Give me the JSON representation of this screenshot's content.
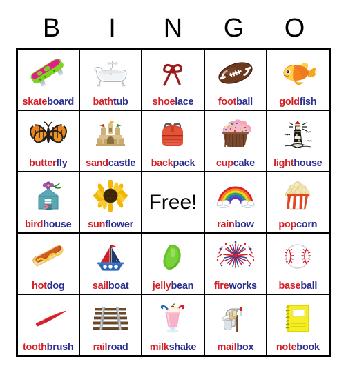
{
  "header": {
    "letters": [
      "B",
      "I",
      "N",
      "G",
      "O"
    ]
  },
  "colors": {
    "syllable_first": "#d31f26",
    "syllable_second": "#2b2f8f",
    "free_text": "#000000",
    "grid_line": "#000000",
    "background": "#ffffff"
  },
  "free_space": {
    "label": "Free!"
  },
  "grid": {
    "rows": 5,
    "columns": 5,
    "cells": [
      [
        {
          "word": "skateboard",
          "seg_a": "skate",
          "seg_b": "board",
          "icon": "skateboard-icon"
        },
        {
          "word": "bathtub",
          "seg_a": "bath",
          "seg_b": "tub",
          "icon": "bathtub-icon"
        },
        {
          "word": "shoelace",
          "seg_a": "shoe",
          "seg_b": "lace",
          "icon": "shoelace-icon"
        },
        {
          "word": "football",
          "seg_a": "foot",
          "seg_b": "ball",
          "icon": "football-icon"
        },
        {
          "word": "goldfish",
          "seg_a": "gold",
          "seg_b": "fish",
          "icon": "goldfish-icon"
        }
      ],
      [
        {
          "word": "butterfly",
          "seg_a": "butter",
          "seg_b": "fly",
          "icon": "butterfly-icon"
        },
        {
          "word": "sandcastle",
          "seg_a": "sand",
          "seg_b": "castle",
          "icon": "sandcastle-icon"
        },
        {
          "word": "backpack",
          "seg_a": "back",
          "seg_b": "pack",
          "icon": "backpack-icon"
        },
        {
          "word": "cupcake",
          "seg_a": "cup",
          "seg_b": "cake",
          "icon": "cupcake-icon"
        },
        {
          "word": "lighthouse",
          "seg_a": "light",
          "seg_b": "house",
          "icon": "lighthouse-icon"
        }
      ],
      [
        {
          "word": "birdhouse",
          "seg_a": "bird",
          "seg_b": "house",
          "icon": "birdhouse-icon"
        },
        {
          "word": "sunflower",
          "seg_a": "sun",
          "seg_b": "flower",
          "icon": "sunflower-icon"
        },
        {
          "word": "Free!",
          "seg_a": "",
          "seg_b": "",
          "icon": "free-space"
        },
        {
          "word": "rainbow",
          "seg_a": "rain",
          "seg_b": "bow",
          "icon": "rainbow-icon"
        },
        {
          "word": "popcorn",
          "seg_a": "pop",
          "seg_b": "corn",
          "icon": "popcorn-icon"
        }
      ],
      [
        {
          "word": "hotdog",
          "seg_a": "hot",
          "seg_b": "dog",
          "icon": "hotdog-icon"
        },
        {
          "word": "sailboat",
          "seg_a": "sail",
          "seg_b": "boat",
          "icon": "sailboat-icon"
        },
        {
          "word": "jellybean",
          "seg_a": "jelly",
          "seg_b": "bean",
          "icon": "jellybean-icon"
        },
        {
          "word": "fireworks",
          "seg_a": "fire",
          "seg_b": "works",
          "icon": "fireworks-icon"
        },
        {
          "word": "baseball",
          "seg_a": "base",
          "seg_b": "ball",
          "icon": "baseball-icon"
        }
      ],
      [
        {
          "word": "toothbrush",
          "seg_a": "tooth",
          "seg_b": "brush",
          "icon": "toothbrush-icon"
        },
        {
          "word": "railroad",
          "seg_a": "rail",
          "seg_b": "road",
          "icon": "railroad-icon"
        },
        {
          "word": "milkshake",
          "seg_a": "milk",
          "seg_b": "shake",
          "icon": "milkshake-icon"
        },
        {
          "word": "mailbox",
          "seg_a": "mail",
          "seg_b": "box",
          "icon": "mailbox-icon"
        },
        {
          "word": "notebook",
          "seg_a": "note",
          "seg_b": "book",
          "icon": "notebook-icon"
        }
      ]
    ]
  }
}
